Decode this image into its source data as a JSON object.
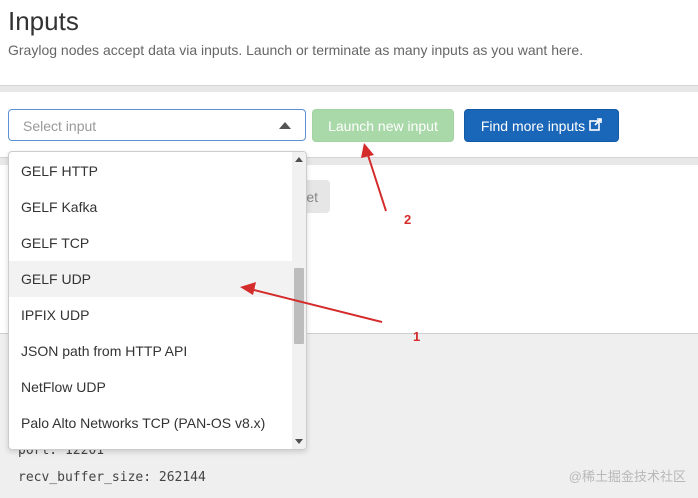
{
  "header": {
    "title": "Inputs",
    "subtitle": "Graylog nodes accept data via inputs. Launch or terminate as many inputs as you want here."
  },
  "toolbar": {
    "select_placeholder": "Select input",
    "launch_label": "Launch new input",
    "find_label": "Find more inputs"
  },
  "dropdown": {
    "options": [
      "GELF HTTP",
      "GELF Kafka",
      "GELF TCP",
      "GELF UDP",
      "IPFIX UDP",
      "JSON path from HTTP API",
      "NetFlow UDP",
      "Palo Alto Networks TCP (PAN-OS v8.x)"
    ],
    "focused": "GELF UDP"
  },
  "background": {
    "ghost_button_fragment": "et",
    "config_lines": [
      "port: 12201",
      "recv_buffer_size: 262144"
    ]
  },
  "annotations": {
    "label_1": "1",
    "label_2": "2",
    "color": "#d42b2b"
  },
  "watermark": "@稀土掘金技术社区",
  "colors": {
    "launch_button": "#a9d8a9",
    "find_button": "#1a66b8",
    "select_border": "#5c8fd3"
  }
}
